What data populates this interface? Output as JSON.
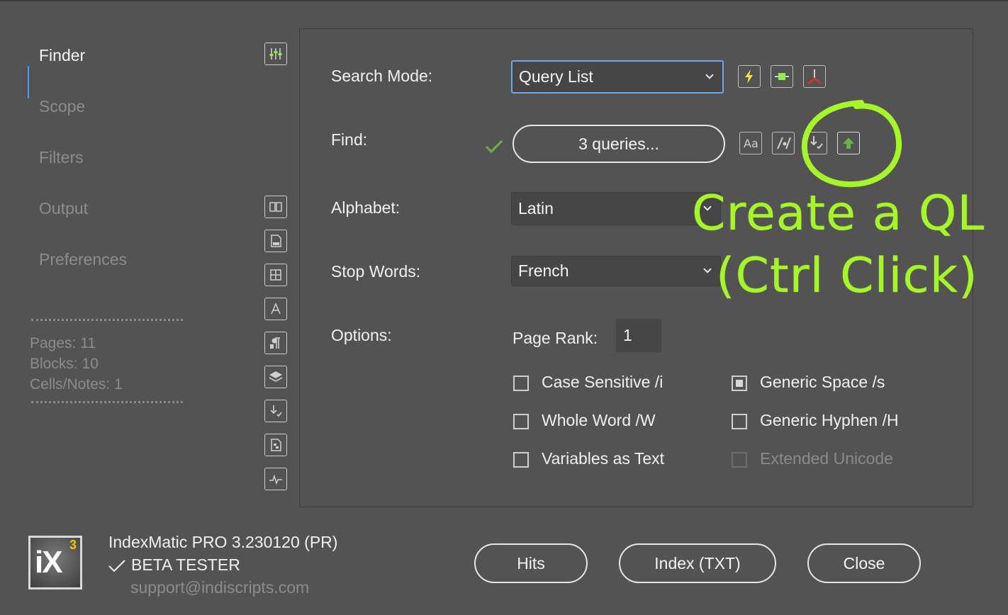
{
  "sidebar": {
    "items": [
      {
        "label": "Finder"
      },
      {
        "label": "Scope"
      },
      {
        "label": "Filters"
      },
      {
        "label": "Output"
      },
      {
        "label": "Preferences"
      }
    ],
    "stats": {
      "pages": "Pages: 11",
      "blocks": "Blocks: 10",
      "cells": "Cells/Notes: 1"
    }
  },
  "form": {
    "search_mode": {
      "label": "Search Mode:",
      "value": "Query List"
    },
    "find": {
      "label": "Find:",
      "button": "3 queries..."
    },
    "alphabet": {
      "label": "Alphabet:",
      "value": "Latin"
    },
    "stop_words": {
      "label": "Stop Words:",
      "value": "French"
    },
    "options": {
      "label": "Options:",
      "page_rank_label": "Page Rank:",
      "page_rank_value": "1",
      "checkboxes": [
        {
          "label": "Case Sensitive /i",
          "checked": false,
          "enabled": true
        },
        {
          "label": "Whole Word /W",
          "checked": false,
          "enabled": true
        },
        {
          "label": "Variables as Text",
          "checked": false,
          "enabled": true
        },
        {
          "label": "Generic Space /s",
          "checked": true,
          "enabled": true
        },
        {
          "label": "Generic Hyphen /H",
          "checked": false,
          "enabled": true
        },
        {
          "label": "Extended Unicode",
          "checked": false,
          "enabled": false
        }
      ]
    }
  },
  "annotation": {
    "line1": "Create a QL",
    "line2": "(Ctrl Click)",
    "color": "#a6f529"
  },
  "footer": {
    "logo_text": "iX",
    "logo_sup": "3",
    "product": "IndexMatic PRO 3.230120 (PR)",
    "license": "BETA TESTER",
    "email": "support@indiscripts.com",
    "buttons": {
      "hits": "Hits",
      "index": "Index (TXT)",
      "close": "Close"
    }
  },
  "colors": {
    "background": "#535353",
    "accent_blue": "#4e9bf0",
    "check_green": "#6db33f",
    "lightning": "#f2e33a"
  }
}
